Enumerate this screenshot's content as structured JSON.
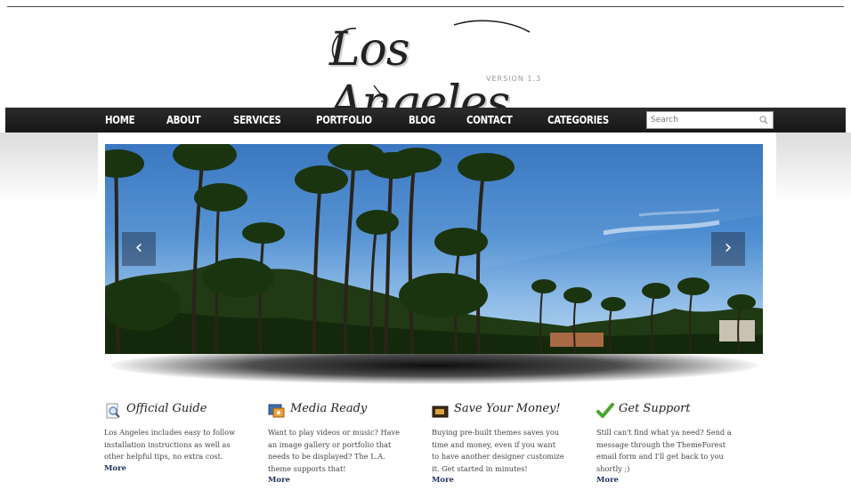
{
  "logo": {
    "title": "Los Angeles",
    "version": "VERSION 1.3"
  },
  "nav": {
    "items": [
      "HOME",
      "ABOUT",
      "SERVICES",
      "PORTFOLIO",
      "BLOG",
      "CONTACT",
      "CATEGORIES"
    ]
  },
  "search": {
    "placeholder": "Search",
    "icon": "magnifier-icon"
  },
  "slider": {
    "prev_label": "‹",
    "next_label": "›",
    "sky_color": "#3f80c9"
  },
  "features": [
    {
      "icon": "magnifier-document-icon",
      "title": "Official Guide",
      "lines": [
        "Los Angeles includes easy to follow",
        "installation instructions as well as",
        "other helpful tips, no extra cost."
      ],
      "more": "More"
    },
    {
      "icon": "media-icon",
      "title": "Media Ready",
      "lines": [
        "Want to play videos or music? Have",
        "an image gallery or portfolio that",
        "needs to be displayed? The L.A.",
        "theme supports that!"
      ],
      "more": "More"
    },
    {
      "icon": "money-box-icon",
      "title": "Save Your Money!",
      "lines": [
        "Buying pre-built themes saves you",
        "time and money, even if you want",
        "to have another designer customize",
        "it. Get started in minutes!"
      ],
      "more": "More"
    },
    {
      "icon": "checkmark-icon",
      "title": "Get Support",
      "lines": [
        "Still can't find what ya need? Send a",
        "message through the ThemeForest",
        "email form and I'll get back to you",
        "shortly ;)"
      ],
      "more": "More"
    }
  ],
  "colors": {
    "nav_bg": "#1e1e1e",
    "more_link": "#1a2e5a",
    "check_green": "#4aa52e"
  }
}
